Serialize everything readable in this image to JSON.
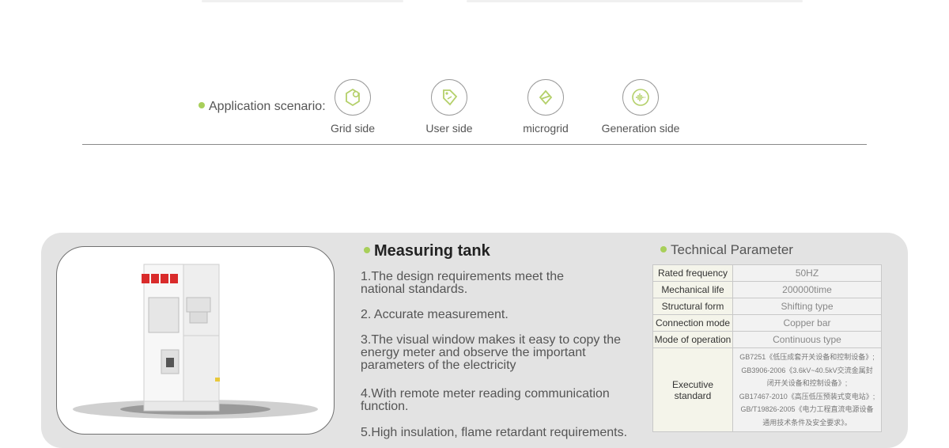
{
  "application": {
    "label": "Application scenario:",
    "scenarios": [
      {
        "label": "Grid side",
        "icon": "grid-side-icon"
      },
      {
        "label": "User side",
        "icon": "user-side-icon"
      },
      {
        "label": "microgrid",
        "icon": "microgrid-icon"
      },
      {
        "label": "Generation side",
        "icon": "generation-side-icon"
      }
    ]
  },
  "product": {
    "title": "Measuring tank",
    "features": [
      "1.The design requirements meet the national standards.",
      "2. Accurate measurement.",
      "3.The visual window makes it easy to copy the energy meter and observe the important parameters of the electricity",
      "4.With remote meter reading communication function.",
      "5.High insulation, flame retardant requirements."
    ]
  },
  "parameters": {
    "title": "Technical Parameter",
    "rows": [
      {
        "key": "Rated frequency",
        "value": "50HZ"
      },
      {
        "key": "Mechanical life",
        "value": "200000time"
      },
      {
        "key": "Structural form",
        "value": "Shifting type"
      },
      {
        "key": "Connection mode",
        "value": "Copper bar"
      },
      {
        "key": "Mode of operation",
        "value": "Continuous type"
      }
    ],
    "standard": {
      "key": "Executive standard",
      "lines": [
        "GB7251《低压成套开关设备和控制设备》;",
        "GB3906-2006《3.6kV~40.5kV交流金属封",
        "闭开关设备和控制设备》;",
        "GB17467-2010《高压低压预装式变电站》;",
        "GB/T19826-2005《电力工程直流电源设备",
        "通用技术条件及安全要求》。"
      ]
    }
  },
  "colors": {
    "accent": "#a8cf5a",
    "panel": "#e3e3e3"
  }
}
